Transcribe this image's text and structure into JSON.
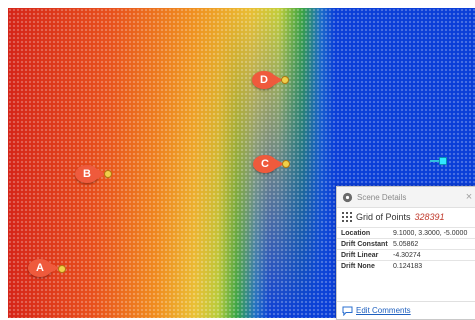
{
  "scene": {
    "labels": [
      "A",
      "B",
      "C",
      "D"
    ],
    "colors": {
      "red": "#d7281a",
      "orange": "#ee7a1c",
      "yellow": "#e9c237",
      "green": "#2e9b3e",
      "blue": "#0a3ed8"
    }
  },
  "panel": {
    "title": "Scene Details",
    "object_name": "Grid of Points",
    "object_id": "328391",
    "properties": [
      {
        "key": "Location",
        "value": "9.1000, 3.3000, -5.0000"
      },
      {
        "key": "Drift Constant",
        "value": "5.05862"
      },
      {
        "key": "Drift Linear",
        "value": "-4.30274"
      },
      {
        "key": "Drift None",
        "value": "0.124183"
      }
    ],
    "edit_comments_label": "Edit Comments",
    "close_glyph": "×"
  },
  "icons": {
    "scene_details": "scene-details-icon",
    "grid": "grid-of-points-icon",
    "comment": "comment-icon",
    "close": "close-icon"
  }
}
